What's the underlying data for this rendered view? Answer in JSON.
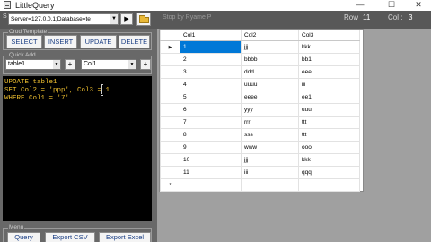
{
  "window": {
    "title": "LittleQuery",
    "controls": {
      "minimize": "—",
      "maximize": "☐",
      "close": "✕"
    }
  },
  "toolbar": {
    "connection_marker": "S",
    "connection_string": "Server=127.0.0.1;Database=te",
    "play_symbol": "▶",
    "file_hint": "Stop by Ryame P",
    "row_label": "Row",
    "row_value": "11",
    "col_label": "Col :",
    "col_value": "3"
  },
  "crud": {
    "title": "Crud Template",
    "buttons": [
      "SELECT",
      "INSERT",
      "UPDATE",
      "DELETE"
    ]
  },
  "quick_add": {
    "title": "Quick Add",
    "table_value": "table1",
    "column_value": "Col1",
    "plus": "+"
  },
  "editor": {
    "lines": [
      "UPDATE table1",
      "SET Col2 = 'ppp', Col3 = 1",
      "WHERE Col1 = '7'"
    ]
  },
  "menu": {
    "title": "Menu",
    "buttons": [
      "Query",
      "Export CSV",
      "Export Excel"
    ]
  },
  "grid": {
    "columns": [
      "Col1",
      "Col2",
      "Col3"
    ],
    "rows": [
      [
        "1",
        "jjj",
        "kkk"
      ],
      [
        "2",
        "bbbb",
        "bb1"
      ],
      [
        "3",
        "ddd",
        "eee"
      ],
      [
        "4",
        "uuuu",
        "iii"
      ],
      [
        "5",
        "eeee",
        "ee1"
      ],
      [
        "6",
        "yyy",
        "uuu"
      ],
      [
        "7",
        "rrr",
        "ttt"
      ],
      [
        "8",
        "sss",
        "ttt"
      ],
      [
        "9",
        "www",
        "ooo"
      ],
      [
        "10",
        "jjj",
        "kkk"
      ],
      [
        "11",
        "iii",
        "qqq"
      ]
    ],
    "current_marker": "▶",
    "new_row_marker": "*",
    "selection_color": "#0078d7"
  }
}
